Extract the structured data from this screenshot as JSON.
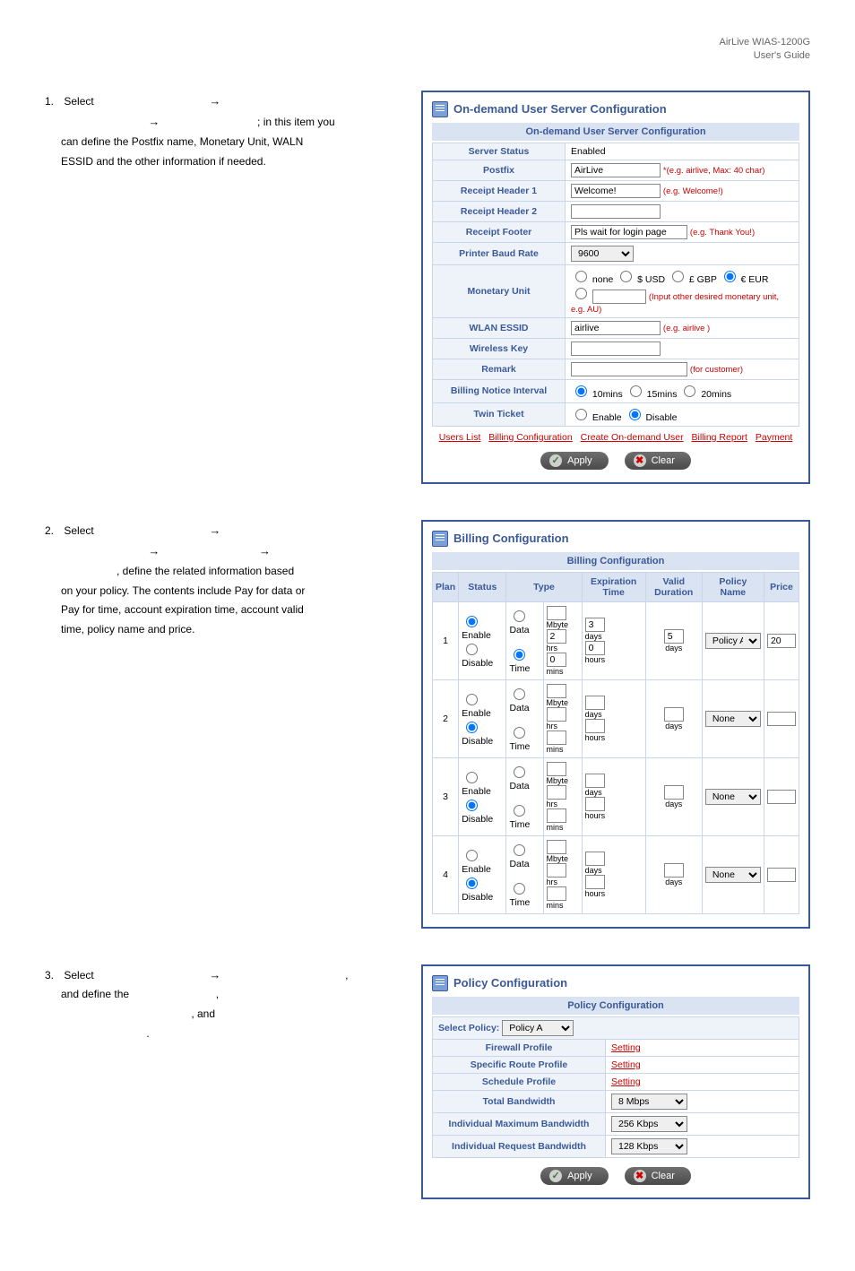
{
  "header": {
    "product": "AirLive WIAS-1200G",
    "doc": "User's Guide"
  },
  "step1": {
    "num": "1.",
    "verb": "Select",
    "tail1": "; in this item you",
    "line2": "can define the Postfix name, Monetary Unit, WALN",
    "line3": "ESSID and the other information if needed."
  },
  "panel1": {
    "title": "On-demand User Server Configuration",
    "subtitle": "On-demand User Server Configuration",
    "rows": {
      "server_status": {
        "label": "Server Status",
        "value": "Enabled"
      },
      "postfix": {
        "label": "Postfix",
        "value": "AirLive",
        "note": "*(e.g. airlive,  Max: 40 char)"
      },
      "rh1": {
        "label": "Receipt Header 1",
        "value": "Welcome!",
        "note": "(e.g. Welcome!)"
      },
      "rh2": {
        "label": "Receipt Header 2",
        "value": ""
      },
      "rfoot": {
        "label": "Receipt Footer",
        "value": "Pls wait for login page",
        "note": "(e.g. Thank You!)"
      },
      "baud": {
        "label": "Printer Baud Rate",
        "value": "9600"
      },
      "mon": {
        "label": "Monetary Unit",
        "opts": [
          "none",
          "$ USD",
          "£ GBP",
          "€ EUR"
        ],
        "note": "(Input other desired monetary unit, e.g. AU)"
      },
      "essid": {
        "label": "WLAN ESSID",
        "value": "airlive",
        "note": "(e.g. airlive )"
      },
      "wkey": {
        "label": "Wireless Key",
        "value": ""
      },
      "remark": {
        "label": "Remark",
        "value": "",
        "note": "(for customer)"
      },
      "bill_int": {
        "label": "Billing Notice Interval",
        "opts": [
          "10mins",
          "15mins",
          "20mins"
        ]
      },
      "twin": {
        "label": "Twin Ticket",
        "opts": [
          "Enable",
          "Disable"
        ]
      }
    },
    "links": [
      "Users List",
      "Billing Configuration",
      "Create On-demand User",
      "Billing Report",
      "Payment"
    ],
    "btn_apply": "Apply",
    "btn_clear": "Clear"
  },
  "step2": {
    "num": "2.",
    "verb": "Select",
    "line2": ", define the related information based",
    "line3": "on your policy. The contents include Pay for data or",
    "line4": "Pay for time, account expiration time, account valid",
    "line5": "time, policy name and price."
  },
  "panel2": {
    "title": "Billing Configuration",
    "subtitle": "Billing Configuration",
    "head": [
      "Plan",
      "Status",
      "Type",
      "Expiration Time",
      "Valid Duration",
      "Policy Name",
      "Price"
    ],
    "rows": [
      {
        "plan": "1",
        "enable": true,
        "data_m": "",
        "data_h": "2",
        "data_min": "0",
        "exp_m": "3",
        "exp_d": "days",
        "exp_h": "0",
        "exp_hn": "hours",
        "valid": "5",
        "valid_u": "days",
        "policy": "Policy A",
        "price": "20"
      },
      {
        "plan": "2",
        "enable": false,
        "valid_u": "days",
        "policy": "None"
      },
      {
        "plan": "3",
        "enable": false,
        "valid_u": "days",
        "policy": "None"
      },
      {
        "plan": "4",
        "enable": false,
        "valid_u": "days",
        "policy": "None"
      }
    ],
    "labels": {
      "enable": "Enable",
      "disable": "Disable",
      "data": "Data",
      "time": "Time",
      "mbyte": "Mbyte",
      "hrs": "hrs",
      "mins": "mins",
      "days": "days",
      "hours": "hours"
    }
  },
  "step3": {
    "num": "3.",
    "verb": "Select",
    "line2a": "and define the",
    "comma": ",",
    "line3": ", and",
    "dot": "."
  },
  "panel3": {
    "title": "Policy Configuration",
    "subtitle": "Policy Configuration",
    "select_label": "Select Policy:",
    "select_val": "Policy A",
    "rows": {
      "fw": {
        "label": "Firewall Profile",
        "val": "Setting"
      },
      "route": {
        "label": "Specific Route Profile",
        "val": "Setting"
      },
      "sched": {
        "label": "Schedule Profile",
        "val": "Setting"
      },
      "tb": {
        "label": "Total Bandwidth",
        "val": "8 Mbps"
      },
      "imb": {
        "label": "Individual Maximum Bandwidth",
        "val": "256 Kbps"
      },
      "irb": {
        "label": "Individual Request Bandwidth",
        "val": "128 Kbps"
      }
    },
    "btn_apply": "Apply",
    "btn_clear": "Clear"
  }
}
